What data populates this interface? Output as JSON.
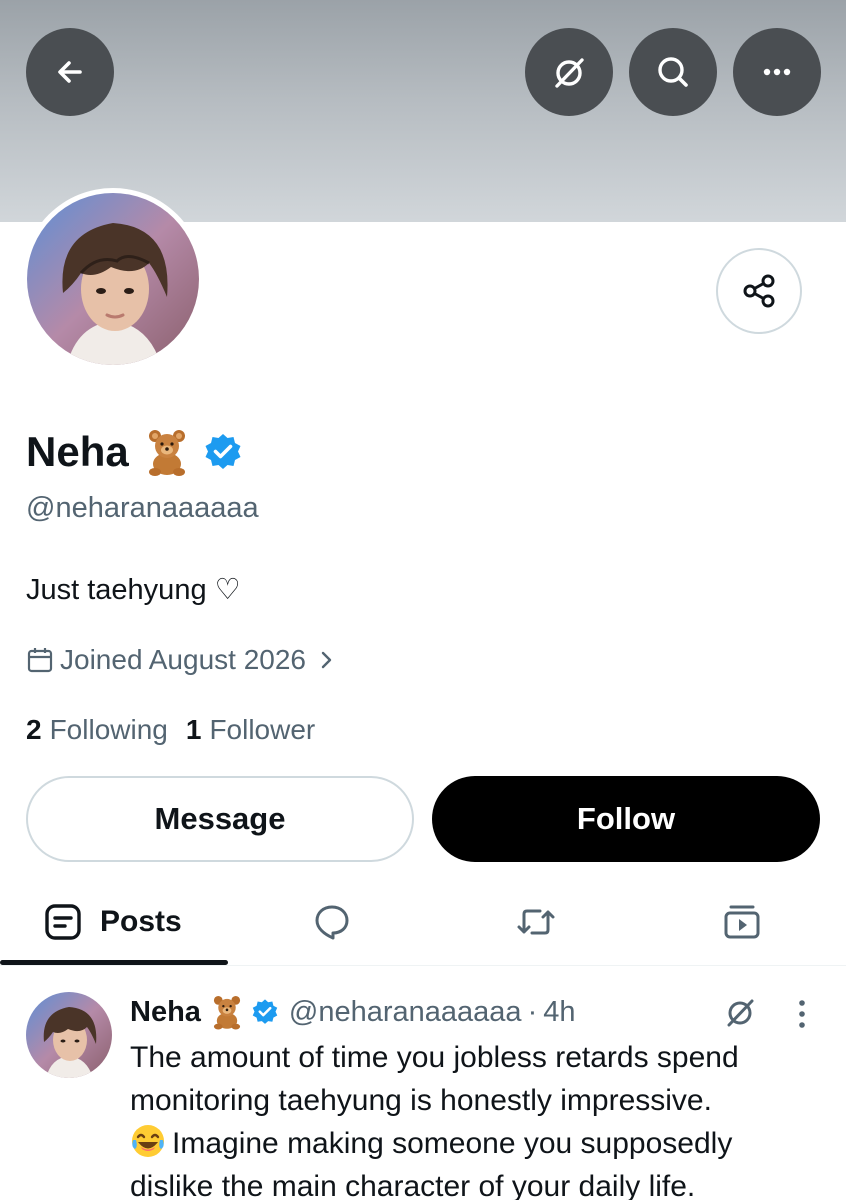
{
  "profile": {
    "name": "Neha",
    "handle": "@neharanaaaaaa",
    "bio": "Just taehyung ♡",
    "joined": "Joined August 2026",
    "following_count": "2",
    "following_label": "Following",
    "followers_count": "1",
    "followers_label": "Follower"
  },
  "actions": {
    "message_label": "Message",
    "follow_label": "Follow"
  },
  "tabs": {
    "posts_label": "Posts"
  },
  "post": {
    "name": "Neha",
    "handle": "@neharanaaaaaa",
    "separator": "·",
    "time": "4h",
    "line1": "The amount of time you jobless retards spend",
    "line2": "monitoring taehyung is honestly impressive.",
    "line3": "Imagine making someone you supposedly",
    "line4": "dislike the main character of your daily life."
  },
  "icons": {
    "back": "arrow-left-icon",
    "grok": "grok-icon",
    "search": "search-icon",
    "more": "more-horizontal-icon",
    "share": "share-icon",
    "calendar": "calendar-icon",
    "verified": "verified-badge-icon",
    "bear": "teddy-bear-emoji",
    "laugh": "tears-of-joy-emoji"
  },
  "colors": {
    "accent": "#1d9bf0",
    "text_primary": "#0f1419",
    "text_secondary": "#536471",
    "follow_button": "#000000",
    "header_button": "#4a4e52"
  }
}
